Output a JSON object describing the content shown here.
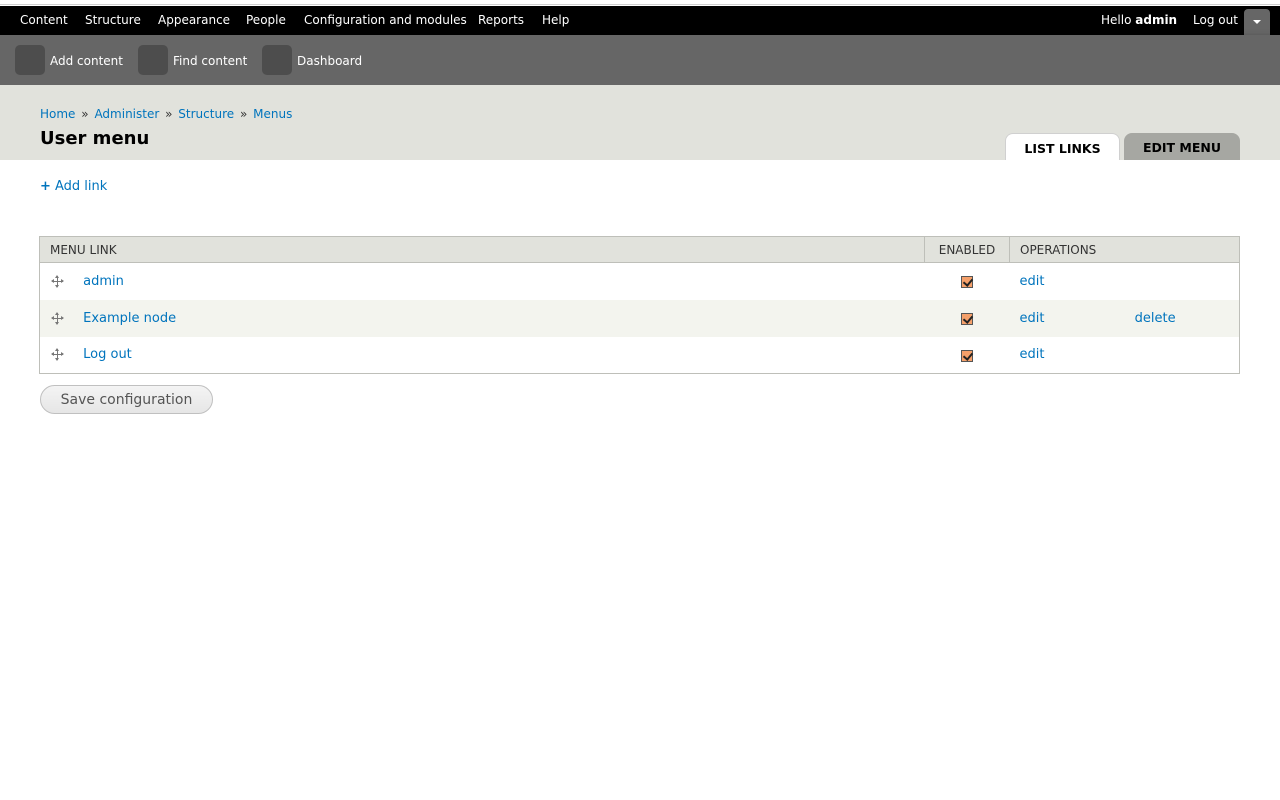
{
  "toolbar": {
    "menu": [
      "Content",
      "Structure",
      "Appearance",
      "People",
      "Configuration and modules",
      "Reports",
      "Help"
    ],
    "hello": "Hello",
    "username": "admin",
    "logout": "Log out"
  },
  "shortcuts": [
    "Add content",
    "Find content",
    "Dashboard"
  ],
  "breadcrumb": [
    "Home",
    "Administer",
    "Structure",
    "Menus"
  ],
  "breadcrumb_sep": "»",
  "page_title": "User menu",
  "tabs": {
    "list_links": "LIST LINKS",
    "edit_menu": "EDIT MENU"
  },
  "add_link": "Add link",
  "table": {
    "headers": {
      "menu_link": "MENU LINK",
      "enabled": "ENABLED",
      "operations": "OPERATIONS"
    },
    "rows": [
      {
        "link": "admin",
        "enabled": true,
        "edit": "edit",
        "delete": ""
      },
      {
        "link": "Example node",
        "enabled": true,
        "edit": "edit",
        "delete": "delete"
      },
      {
        "link": "Log out",
        "enabled": true,
        "edit": "edit",
        "delete": ""
      }
    ]
  },
  "save_button": "Save configuration",
  "colors": {
    "link": "#0074bd",
    "toolbar_bg": "#000000",
    "shortcut_bg": "#666666",
    "header_bg": "#e1e2dc",
    "checkbox": "#f5a06a"
  }
}
